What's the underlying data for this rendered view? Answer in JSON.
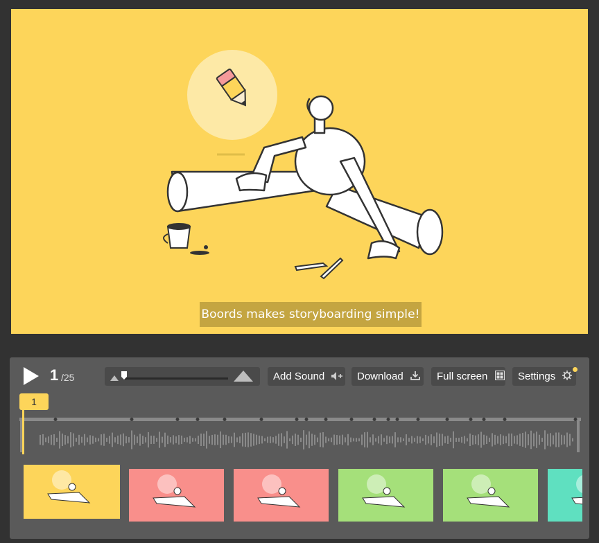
{
  "stage": {
    "background": "#fdd55a",
    "caption": "Boords makes storyboarding simple!"
  },
  "controls": {
    "current_frame": "1",
    "total_frames": "/25",
    "add_sound_label": "Add Sound",
    "download_label": "Download",
    "fullscreen_label": "Full screen",
    "settings_label": "Settings",
    "playhead_label": "1",
    "accent_color": "#fdd55a"
  },
  "icons": {
    "play": "play-icon",
    "zoom_small": "mountain-small-icon",
    "zoom_large": "mountain-large-icon",
    "sound": "speaker-plus-icon",
    "download": "download-icon",
    "fullscreen": "grid-icon",
    "settings": "gear-icon"
  },
  "thumbnails": [
    {
      "color": "#fdd55a",
      "selected": true
    },
    {
      "color": "#f98f8b",
      "selected": false
    },
    {
      "color": "#f98f8b",
      "selected": false
    },
    {
      "color": "#a5e07a",
      "selected": false
    },
    {
      "color": "#a5e07a",
      "selected": false
    },
    {
      "color": "#5fe0c0",
      "selected": false
    }
  ]
}
